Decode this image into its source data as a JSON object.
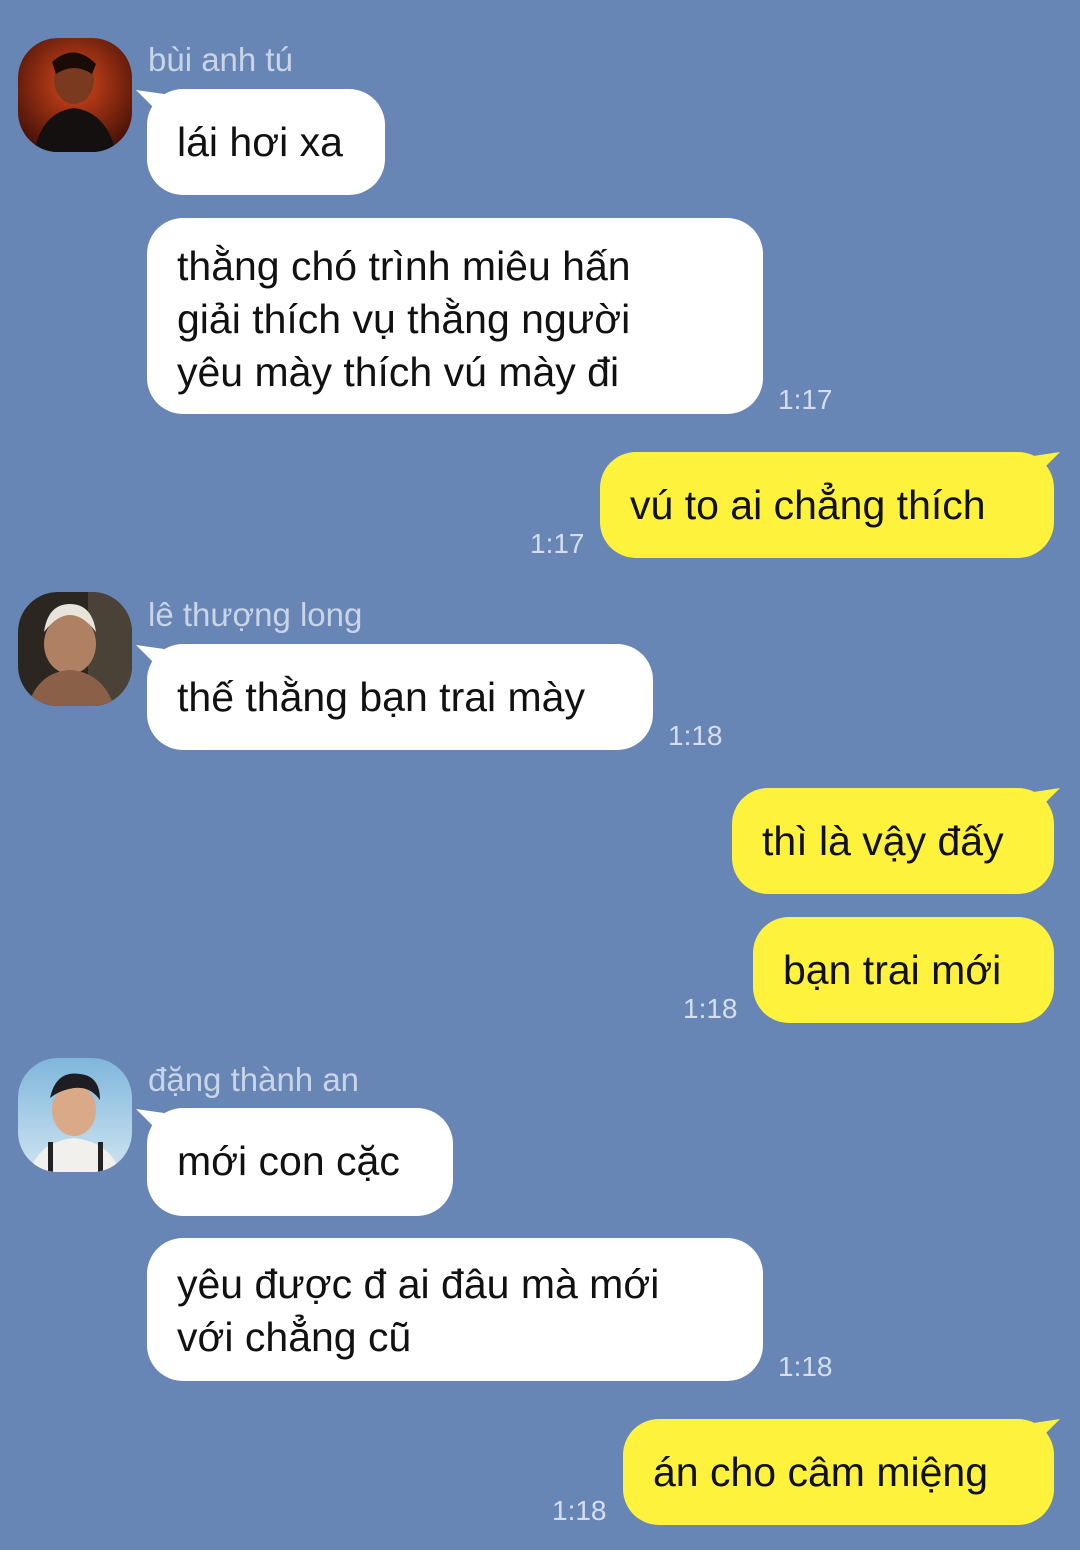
{
  "colors": {
    "background": "#6886b5",
    "incoming_bubble": "#ffffff",
    "outgoing_bubble": "#fef23c"
  },
  "messages": [
    {
      "sender": "bùi anh tú",
      "avatar": "avatar-icon",
      "text": "lái hơi xa"
    },
    {
      "text": "thằng chó trình miêu hấn\ngiải thích vụ thằng người\nyêu mày thích vú mày đi",
      "time": "1:17"
    },
    {
      "outgoing": true,
      "text": "vú to ai chẳng thích",
      "time": "1:17"
    },
    {
      "sender": "lê thượng long",
      "avatar": "avatar-icon",
      "text": "thế thằng bạn trai mày",
      "time": "1:18"
    },
    {
      "outgoing": true,
      "text": "thì là vậy đấy"
    },
    {
      "outgoing": true,
      "text": "bạn trai mới",
      "time": "1:18"
    },
    {
      "sender": "đặng thành an",
      "avatar": "avatar-icon",
      "text": "mới con cặc"
    },
    {
      "text": "yêu được đ ai đâu mà mới\nvới chẳng cũ",
      "time": "1:18"
    },
    {
      "outgoing": true,
      "text": "án cho câm miệng",
      "time": "1:18"
    }
  ]
}
